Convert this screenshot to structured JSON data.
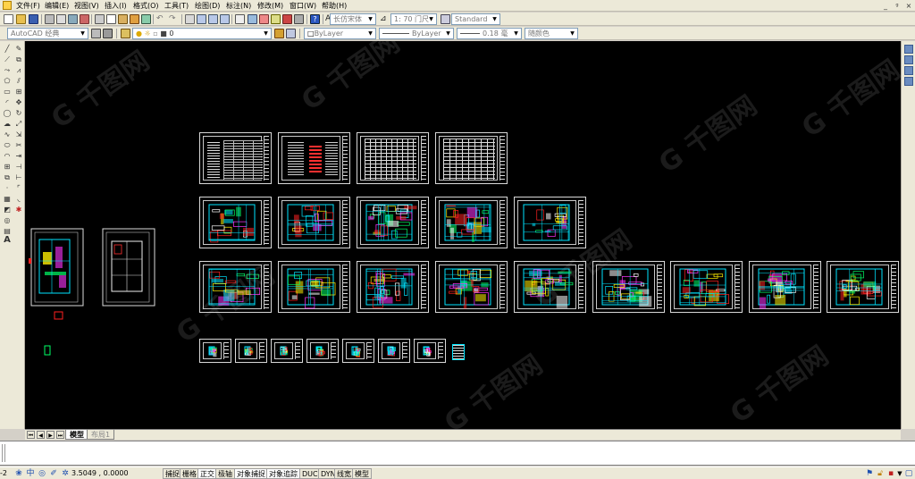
{
  "menu": {
    "items": [
      "文件(F)",
      "编辑(E)",
      "视图(V)",
      "插入(I)",
      "格式(O)",
      "工具(T)",
      "绘图(D)",
      "标注(N)",
      "修改(M)",
      "窗口(W)",
      "帮助(H)"
    ],
    "window_controls": [
      "_",
      "ᵍ",
      "×"
    ]
  },
  "toolbar_top": {
    "text_style_combo": "长仿宋体",
    "scale_combo": "1: 70 门尺",
    "standard_combo": "Standard"
  },
  "toolbar_props": {
    "workspace_combo": "AutoCAD 经典",
    "layer_combo": "0",
    "color_combo": "ByLayer",
    "linetype_combo": "ByLayer",
    "lineweight_combo": "0.18 毫",
    "plotstyle_combo": "随颜色"
  },
  "left_tools": [
    "line",
    "construction-line",
    "polyline",
    "polygon",
    "rectangle",
    "arc",
    "circle",
    "revision-cloud",
    "spline",
    "ellipse",
    "ellipse-arc",
    "insert-block",
    "make-block",
    "point",
    "hatch",
    "gradient",
    "region",
    "table",
    "multiline-text"
  ],
  "text_tool_label": "A",
  "tabs": {
    "items": [
      "模型",
      "布局1"
    ],
    "active": "模型"
  },
  "status": {
    "coordinates": "3.5049 , 0.0000",
    "left_clip": "-2",
    "toggles": [
      "捕捉",
      "栅格",
      "正交",
      "极轴",
      "对象捕捉",
      "对象追踪",
      "DUCS",
      "DYN",
      "线宽",
      "模型"
    ]
  },
  "watermark_text": "G 千图网",
  "colors": {
    "canvas": "#000000",
    "sheet_border": "#d8d8d8",
    "cyan_lines": "#00e5ff",
    "yellow_lines": "#ffee00",
    "magenta_lines": "#ff33ff",
    "red_lines": "#ff2020",
    "chrome": "#ece9d8"
  }
}
